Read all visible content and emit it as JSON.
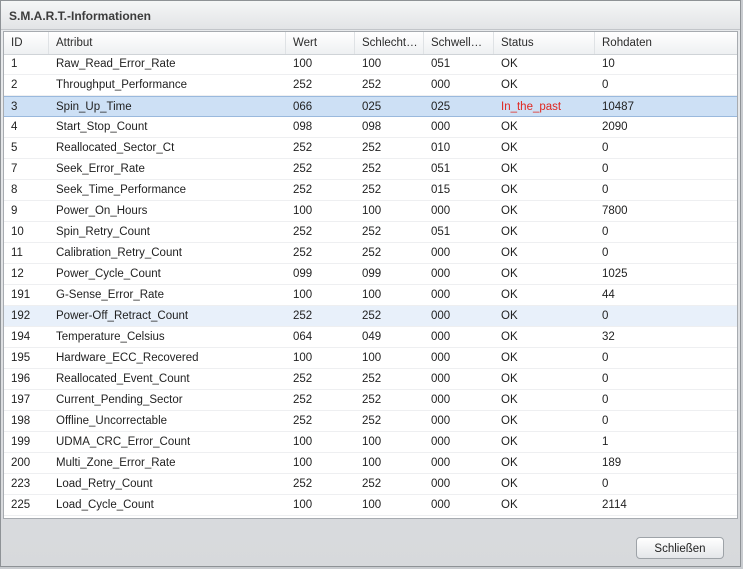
{
  "window": {
    "title": "S.M.A.R.T.-Informationen"
  },
  "table": {
    "columns": [
      "ID",
      "Attribut",
      "Wert",
      "Schlecht…",
      "Schwell…",
      "Status",
      "Rohdaten"
    ],
    "rows": [
      [
        "1",
        "Raw_Read_Error_Rate",
        "100",
        "100",
        "051",
        "OK",
        "10"
      ],
      [
        "2",
        "Throughput_Performance",
        "252",
        "252",
        "000",
        "OK",
        "0"
      ],
      [
        "3",
        "Spin_Up_Time",
        "066",
        "025",
        "025",
        "In_the_past",
        "10487"
      ],
      [
        "4",
        "Start_Stop_Count",
        "098",
        "098",
        "000",
        "OK",
        "2090"
      ],
      [
        "5",
        "Reallocated_Sector_Ct",
        "252",
        "252",
        "010",
        "OK",
        "0"
      ],
      [
        "7",
        "Seek_Error_Rate",
        "252",
        "252",
        "051",
        "OK",
        "0"
      ],
      [
        "8",
        "Seek_Time_Performance",
        "252",
        "252",
        "015",
        "OK",
        "0"
      ],
      [
        "9",
        "Power_On_Hours",
        "100",
        "100",
        "000",
        "OK",
        "7800"
      ],
      [
        "10",
        "Spin_Retry_Count",
        "252",
        "252",
        "051",
        "OK",
        "0"
      ],
      [
        "11",
        "Calibration_Retry_Count",
        "252",
        "252",
        "000",
        "OK",
        "0"
      ],
      [
        "12",
        "Power_Cycle_Count",
        "099",
        "099",
        "000",
        "OK",
        "1025"
      ],
      [
        "191",
        "G-Sense_Error_Rate",
        "100",
        "100",
        "000",
        "OK",
        "44"
      ],
      [
        "192",
        "Power-Off_Retract_Count",
        "252",
        "252",
        "000",
        "OK",
        "0"
      ],
      [
        "194",
        "Temperature_Celsius",
        "064",
        "049",
        "000",
        "OK",
        "32"
      ],
      [
        "195",
        "Hardware_ECC_Recovered",
        "100",
        "100",
        "000",
        "OK",
        "0"
      ],
      [
        "196",
        "Reallocated_Event_Count",
        "252",
        "252",
        "000",
        "OK",
        "0"
      ],
      [
        "197",
        "Current_Pending_Sector",
        "252",
        "252",
        "000",
        "OK",
        "0"
      ],
      [
        "198",
        "Offline_Uncorrectable",
        "252",
        "252",
        "000",
        "OK",
        "0"
      ],
      [
        "199",
        "UDMA_CRC_Error_Count",
        "100",
        "100",
        "000",
        "OK",
        "1"
      ],
      [
        "200",
        "Multi_Zone_Error_Rate",
        "100",
        "100",
        "000",
        "OK",
        "189"
      ],
      [
        "223",
        "Load_Retry_Count",
        "252",
        "252",
        "000",
        "OK",
        "0"
      ],
      [
        "225",
        "Load_Cycle_Count",
        "100",
        "100",
        "000",
        "OK",
        "2114"
      ]
    ],
    "selected_row_index": 2,
    "hover_row_index": 12,
    "warning_color": "#e0261f"
  },
  "footer": {
    "close_label": "Schließen"
  }
}
